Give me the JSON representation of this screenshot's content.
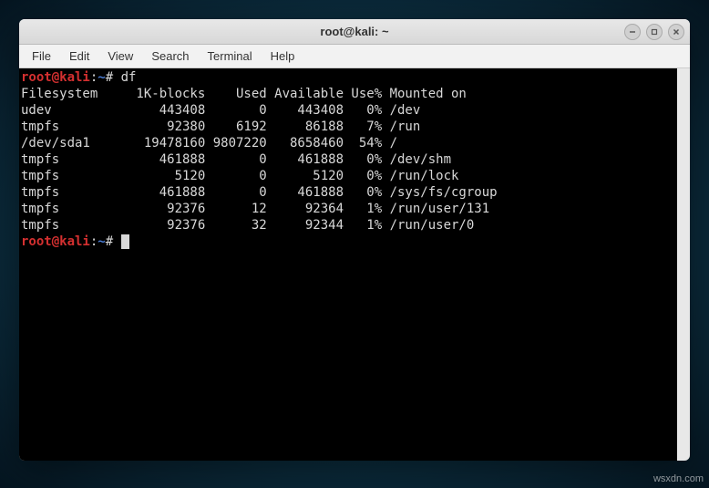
{
  "window": {
    "title": "root@kali: ~"
  },
  "menubar": {
    "items": [
      "File",
      "Edit",
      "View",
      "Search",
      "Terminal",
      "Help"
    ]
  },
  "prompt": {
    "user_host": "root@kali",
    "colon": ":",
    "path": "~",
    "hash": "# "
  },
  "command1": "df",
  "df_header": "Filesystem     1K-blocks    Used Available Use% Mounted on",
  "df_rows": [
    "udev              443408       0    443408   0% /dev",
    "tmpfs              92380    6192     86188   7% /run",
    "/dev/sda1       19478160 9807220   8658460  54% /",
    "tmpfs             461888       0    461888   0% /dev/shm",
    "tmpfs               5120       0      5120   0% /run/lock",
    "tmpfs             461888       0    461888   0% /sys/fs/cgroup",
    "tmpfs              92376      12     92364   1% /run/user/131",
    "tmpfs              92376      32     92344   1% /run/user/0"
  ],
  "watermark": "wsxdn.com"
}
